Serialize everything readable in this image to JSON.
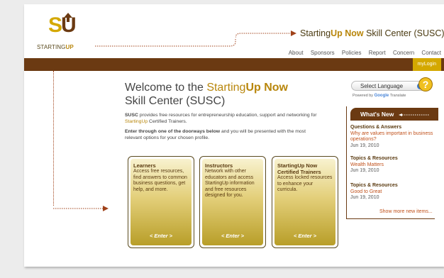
{
  "logo": {
    "mark": "SU",
    "text_prefix": "STARTING",
    "text_suffix": "UP"
  },
  "site_title": {
    "prefix": "Starting",
    "brand_up": "Up",
    "brand_now": " Now",
    "suffix": " Skill Center (SUSC)"
  },
  "topnav": [
    "About",
    "Sponsors",
    "Policies",
    "Report",
    "Concern",
    "Contact"
  ],
  "mylogin": "myLogin",
  "welcome": {
    "line1_prefix": "Welcome to the ",
    "line1_brand_a": "Starting",
    "line1_brand_b": "Up Now",
    "line2": "Skill Center (SUSC)"
  },
  "intro": {
    "p1_bold": "SUSC",
    "p1_text": " provides free resources for entrepreneurship education, support and networking for ",
    "p1_brand_a": "Starting",
    "p1_brand_b": "Up",
    "p1_tail": " Certified Trainers.",
    "p2_bold": "Enter through one of the doorways below",
    "p2_text": " and you will be presented with the most relevant options for your chosen profile."
  },
  "doors": [
    {
      "title": "Learners",
      "desc": "Access free resources, find answers to common business questions, get help, and more.",
      "enter": "< Enter >"
    },
    {
      "title": "Instructors",
      "desc": "Network with other educators and access StartingUp information and free resources designed for you.",
      "enter": "< Enter >"
    },
    {
      "title": "StartingUp Now Certified Trainers",
      "desc": "Access locked resources to enhance your curricula.",
      "enter": "< Enter >"
    }
  ],
  "language": {
    "label": "Select Language",
    "powered_by": "Powered by",
    "google": "Google",
    "translate": "Translate"
  },
  "whats_new": {
    "heading": "What's New",
    "items": [
      {
        "category": "Questions & Answers",
        "title": "Why are values important in business operations?",
        "date": "Jun 19, 2010"
      },
      {
        "category": "Topics & Resources",
        "title": "Wealth Matters",
        "date": "Jun 19, 2010"
      },
      {
        "category": "Topics & Resources",
        "title": "Good to Great",
        "date": "Jun 19, 2010"
      }
    ],
    "more": "Show more new items..."
  },
  "colors": {
    "brown": "#6b3a12",
    "gold": "#b8860b",
    "accent": "#c0501a"
  }
}
